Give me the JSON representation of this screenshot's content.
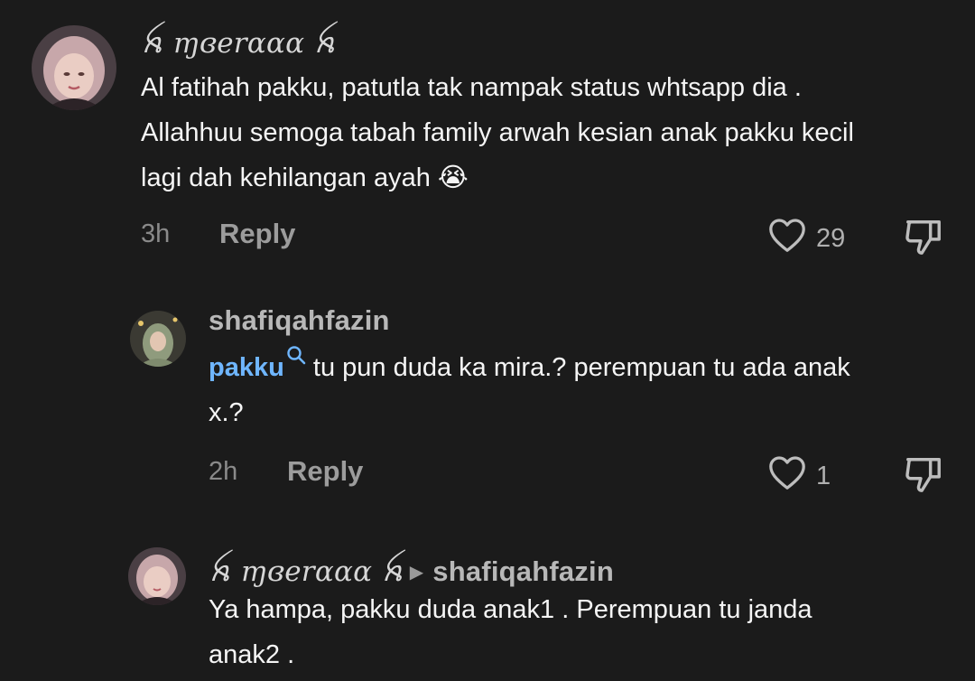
{
  "comments": [
    {
      "username": "ꫝ ɱɞerααα ꫝ",
      "text_lines": [
        "Al fatihah pakku, patutla tak nampak status whtsapp dia .",
        "Allahhuu semoga tabah family arwah kesian anak pakku kecil",
        "lagi dah kehilangan ayah 😭"
      ],
      "time": "3h",
      "reply_label": "Reply",
      "likes": "29"
    },
    {
      "username": "shafiqahfazin",
      "mention": "pakku",
      "text_line1_rest": " tu pun duda ka mira.? perempuan tu ada anak",
      "text_line2": "x.?",
      "time": "2h",
      "reply_label": "Reply",
      "likes": "1"
    },
    {
      "username": "ꫝ ɱɞerααα ꫝ",
      "reply_to": "shafiqahfazin",
      "text_lines": [
        "Ya hampa, pakku duda anak1 . Perempuan tu janda",
        "anak2 ."
      ]
    }
  ],
  "icons": {
    "heart": "heart-outline-icon",
    "dislike": "thumb-down-icon",
    "mention_search": "search-icon",
    "reply_arrow": "triangle-right-icon"
  },
  "colors": {
    "background": "#1b1b1b",
    "mention": "#6fb6ff",
    "username": "#b8b8b8",
    "meta": "#8a8a8a"
  }
}
